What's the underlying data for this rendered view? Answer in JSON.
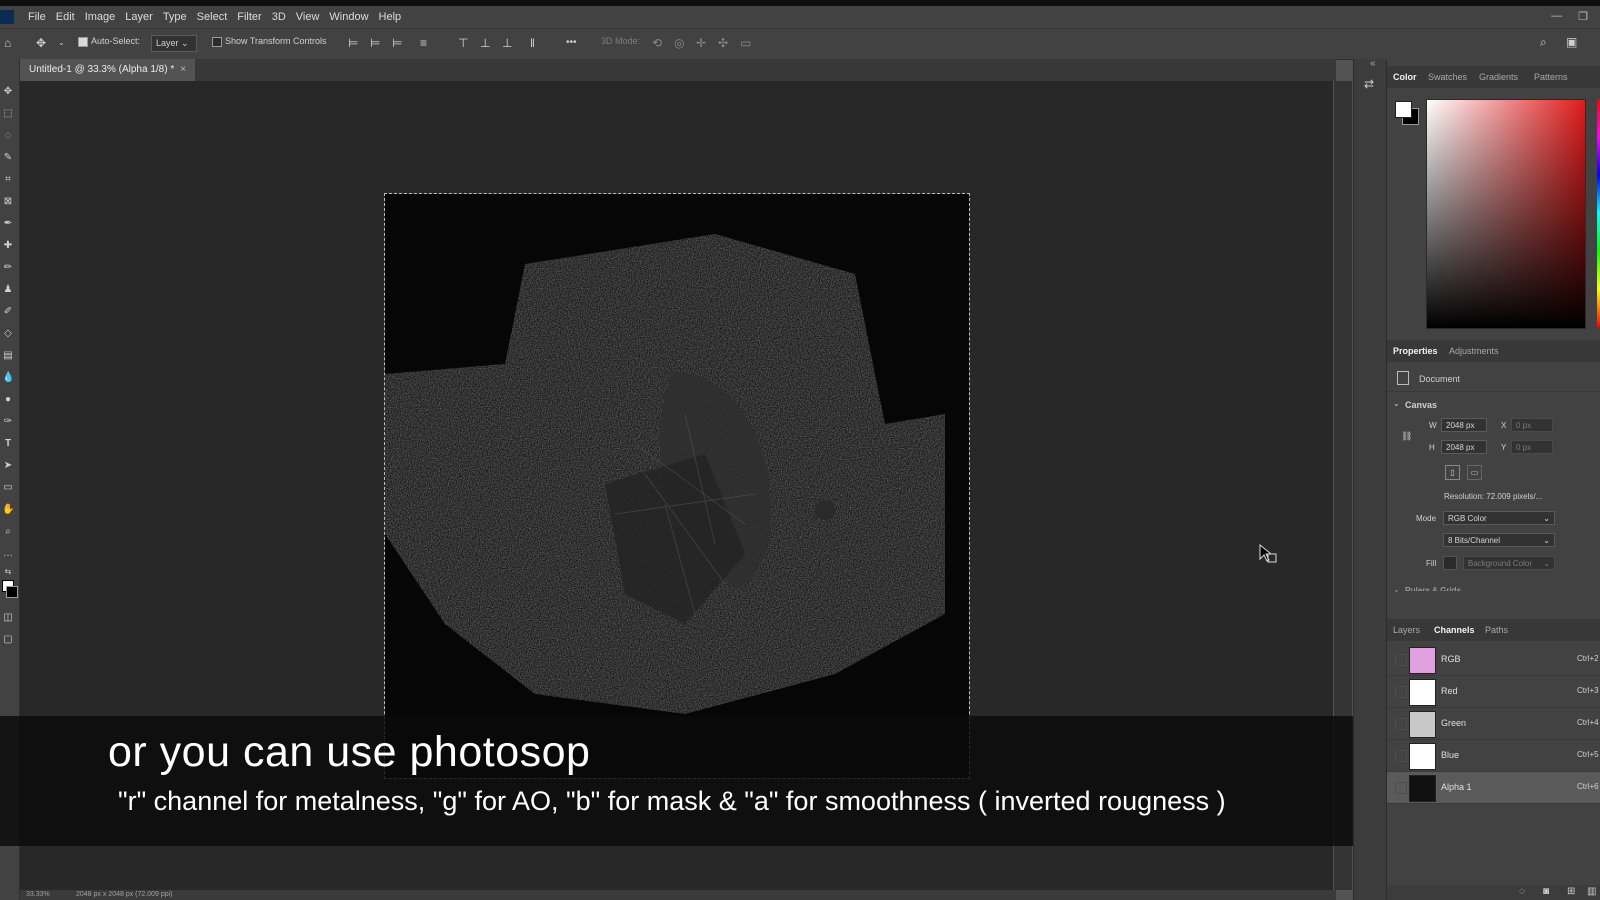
{
  "menu": {
    "items": [
      "File",
      "Edit",
      "Image",
      "Layer",
      "Type",
      "Select",
      "Filter",
      "3D",
      "View",
      "Window",
      "Help"
    ]
  },
  "options_bar": {
    "auto_select_label": "Auto-Select:",
    "layer_select_value": "Layer",
    "show_transform_label": "Show Transform Controls",
    "more_label": "•••",
    "mode_3d_label": "3D Mode:"
  },
  "document": {
    "tab_title": "Untitled-1 @ 33.3% (Alpha 1/8) *",
    "close_glyph": "×"
  },
  "status_bar": {
    "zoom": "33.33%",
    "doc_info": "2048 px x 2048 px (72.009 ppi)"
  },
  "subtitles": {
    "line1": "or you can use photosop",
    "line2": "\"r\" channel for metalness, \"g\" for AO, \"b\" for mask & \"a\" for smoothness ( inverted rougness )"
  },
  "color_panel": {
    "tabs": [
      "Color",
      "Swatches",
      "Gradients",
      "Patterns"
    ],
    "foreground": "#ffffff",
    "background": "#000000"
  },
  "properties_panel": {
    "tabs": [
      "Properties",
      "Adjustments"
    ],
    "doc_label": "Document",
    "canvas_label": "Canvas",
    "w_label": "W",
    "w_value": "2048 px",
    "h_label": "H",
    "h_value": "2048 px",
    "x_label": "X",
    "x_value": "0 px",
    "y_label": "Y",
    "y_value": "0 px",
    "resolution": "Resolution: 72.009 pixels/...",
    "mode_label": "Mode",
    "mode_value": "RGB Color",
    "bits_value": "8 Bits/Channel",
    "fill_label": "Fill",
    "fill_value": "Background Color",
    "rulers_label": "Rulers & Grids"
  },
  "channels_panel": {
    "tabs": [
      "Layers",
      "Channels",
      "Paths"
    ],
    "channels": [
      {
        "name": "RGB",
        "key": "Ctrl+2"
      },
      {
        "name": "Red",
        "key": "Ctrl+3"
      },
      {
        "name": "Green",
        "key": "Ctrl+4"
      },
      {
        "name": "Blue",
        "key": "Ctrl+5"
      },
      {
        "name": "Alpha 1",
        "key": "Ctrl+6"
      }
    ]
  }
}
